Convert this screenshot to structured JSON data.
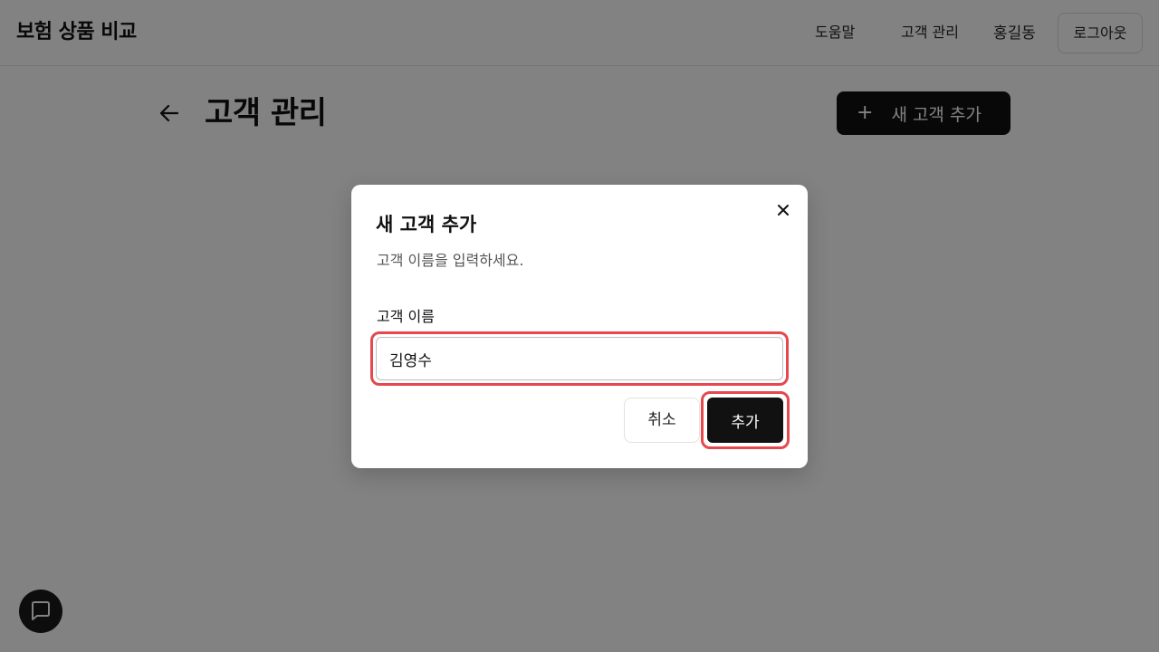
{
  "header": {
    "app_title": "보험 상품 비교",
    "nav": {
      "help": "도움말",
      "customers": "고객 관리",
      "user_name": "홍길동",
      "logout": "로그아웃"
    }
  },
  "main": {
    "title": "고객 관리",
    "add_button_icon": "+",
    "add_button_label": "새 고객 추가"
  },
  "dialog": {
    "title": "새 고객 추가",
    "description": "고객 이름을 입력하세요.",
    "field_label": "고객 이름",
    "field_value": "김영수",
    "cancel_label": "취소",
    "confirm_label": "추가",
    "close_icon": "close-icon"
  },
  "icons": {
    "back": "arrow-left-icon",
    "chat": "chat-bubble-icon"
  },
  "colors": {
    "primary": "#111111",
    "highlight": "#e5484d",
    "overlay": "rgba(0,0,0,0.49)"
  }
}
